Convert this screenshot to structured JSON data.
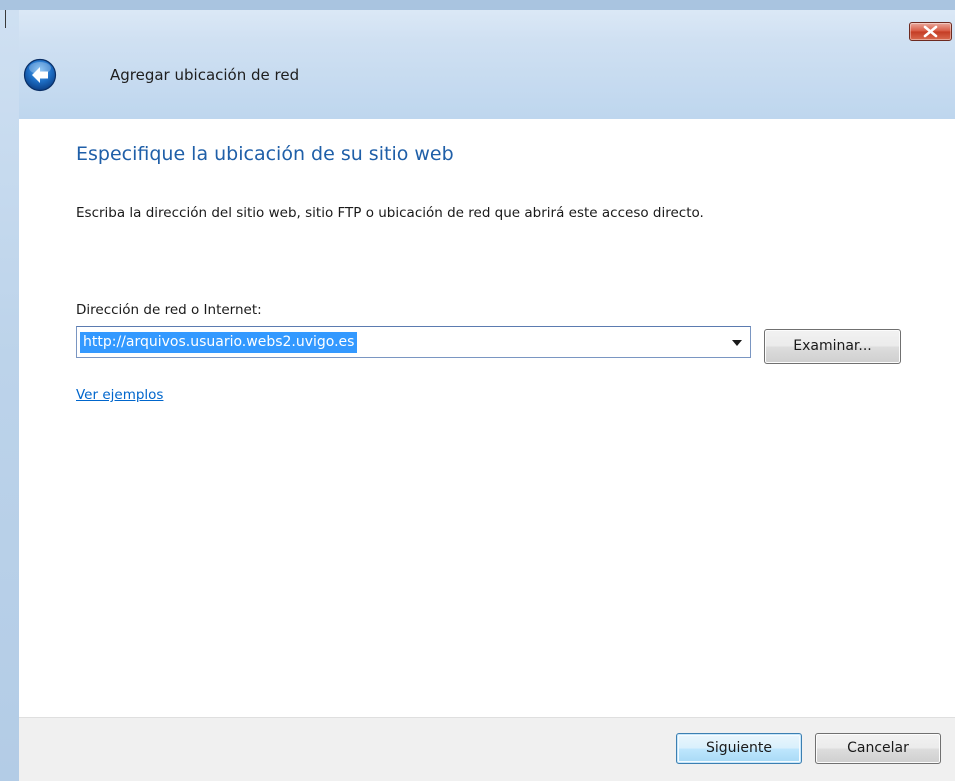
{
  "window": {
    "title": "Agregar ubicación de red"
  },
  "icons": {
    "back": "back-arrow-icon",
    "close": "close-icon",
    "dropdown": "chevron-down-icon"
  },
  "colors": {
    "heading": "#1f5fa8",
    "link": "#0066cc",
    "selection": "#3399ff",
    "close_button": "#c43b23"
  },
  "content": {
    "heading": "Especifique la ubicación de su sitio web",
    "description": "Escriba la dirección del sitio web, sitio FTP o ubicación de red que abrirá este acceso directo.",
    "address_label": "Dirección de red o Internet:",
    "address_value": "http://arquivos.usuario.webs2.uvigo.es",
    "browse_label": "Examinar...",
    "examples_link": "Ver ejemplos"
  },
  "footer": {
    "next_label": "Siguiente",
    "cancel_label": "Cancelar"
  }
}
